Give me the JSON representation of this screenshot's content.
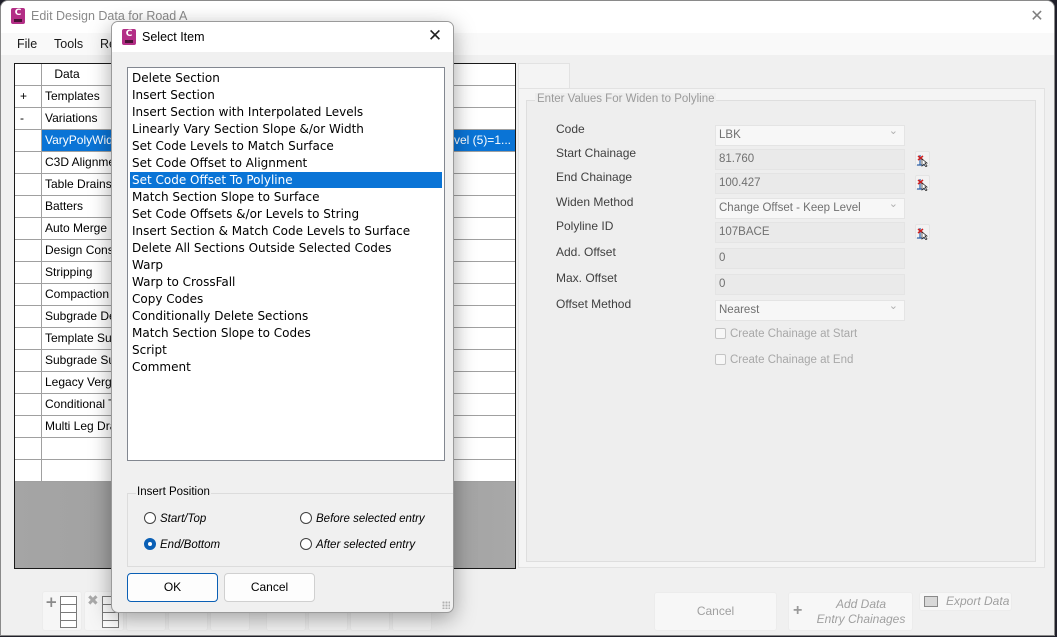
{
  "main_window": {
    "title": "Edit Design Data for Road A",
    "app_icon_letter": "C",
    "close_glyph": "✕",
    "menu": [
      "File",
      "Tools",
      "Re"
    ]
  },
  "grid": {
    "header": {
      "expand": "",
      "data": "Data"
    },
    "rows": [
      {
        "expand": "+",
        "data": "Templates",
        "detail": ""
      },
      {
        "expand": "-",
        "data": "Variations",
        "detail": ""
      },
      {
        "expand": "",
        "data": "VaryPolyWide",
        "detail": "vel  (5)=1...",
        "selected": true
      },
      {
        "expand": "",
        "data": "C3D Alignme",
        "detail": ""
      },
      {
        "expand": "",
        "data": "Table Drains",
        "detail": ""
      },
      {
        "expand": "",
        "data": "Batters",
        "detail": ""
      },
      {
        "expand": "",
        "data": "Auto Merge",
        "detail": ""
      },
      {
        "expand": "",
        "data": "Design Const",
        "detail": ""
      },
      {
        "expand": "",
        "data": "Stripping",
        "detail": ""
      },
      {
        "expand": "",
        "data": "Compaction",
        "detail": ""
      },
      {
        "expand": "",
        "data": "Subgrade De",
        "detail": ""
      },
      {
        "expand": "",
        "data": "Template Sup",
        "detail": ""
      },
      {
        "expand": "",
        "data": "Subgrade Su",
        "detail": ""
      },
      {
        "expand": "",
        "data": "Legacy Verge",
        "detail": ""
      },
      {
        "expand": "",
        "data": "Conditional T",
        "detail": ""
      },
      {
        "expand": "",
        "data": "Multi Leg Dra",
        "detail": ""
      },
      {
        "expand": "",
        "data": "",
        "detail": ""
      },
      {
        "expand": "",
        "data": "",
        "detail": ""
      }
    ]
  },
  "panel": {
    "group_title": "Enter Values For Widen to Polyline",
    "fields": [
      {
        "label": "Code",
        "value": "LBK",
        "type": "combo"
      },
      {
        "label": "Start Chainage",
        "value": "81.760",
        "type": "text",
        "pick": true
      },
      {
        "label": "End Chainage",
        "value": "100.427",
        "type": "text",
        "pick": true
      },
      {
        "label": "Widen Method",
        "value": "Change Offset - Keep Level",
        "type": "combo"
      },
      {
        "label": "Polyline ID",
        "value": "107BACE",
        "type": "text",
        "pick": true
      },
      {
        "label": "Add. Offset",
        "value": "0",
        "type": "text"
      },
      {
        "label": "Max. Offset",
        "value": "0",
        "type": "text"
      },
      {
        "label": "Offset Method",
        "value": "Nearest",
        "type": "combo"
      }
    ],
    "checkboxes": [
      {
        "label": "Create Chainage at Start",
        "checked": false
      },
      {
        "label": "Create Chainage at End",
        "checked": false
      }
    ]
  },
  "bottom_buttons": {
    "cancel": "Cancel",
    "add_data_line1": "Add Data",
    "add_data_line2": "Entry Chainages",
    "export": "Export Data"
  },
  "dialog": {
    "title": "Select Item",
    "close_glyph": "✕",
    "items": [
      "Delete Section",
      "Insert Section",
      "Insert Section with Interpolated Levels",
      "Linearly Vary Section Slope &/or Width",
      "Set Code Levels to Match Surface",
      "Set Code Offset to Alignment",
      "Set Code Offset To Polyline",
      "Match Section Slope to Surface",
      "Set Code Offsets &/or Levels to String",
      "Insert Section & Match Code Levels to Surface",
      "Delete All Sections Outside Selected Codes",
      "Warp",
      "Warp to CrossFall",
      "Copy Codes",
      "Conditionally Delete Sections",
      "Match Section Slope to Codes",
      "Script",
      "Comment"
    ],
    "selected_index": 6,
    "insert_position": {
      "label": "Insert Position",
      "options": [
        "Start/Top",
        "End/Bottom",
        "Before selected entry",
        "After selected entry"
      ],
      "selected": "End/Bottom"
    },
    "ok": "OK",
    "cancel": "Cancel"
  },
  "colors": {
    "selection": "#0a74d6",
    "app_icon": "#b32e86"
  }
}
